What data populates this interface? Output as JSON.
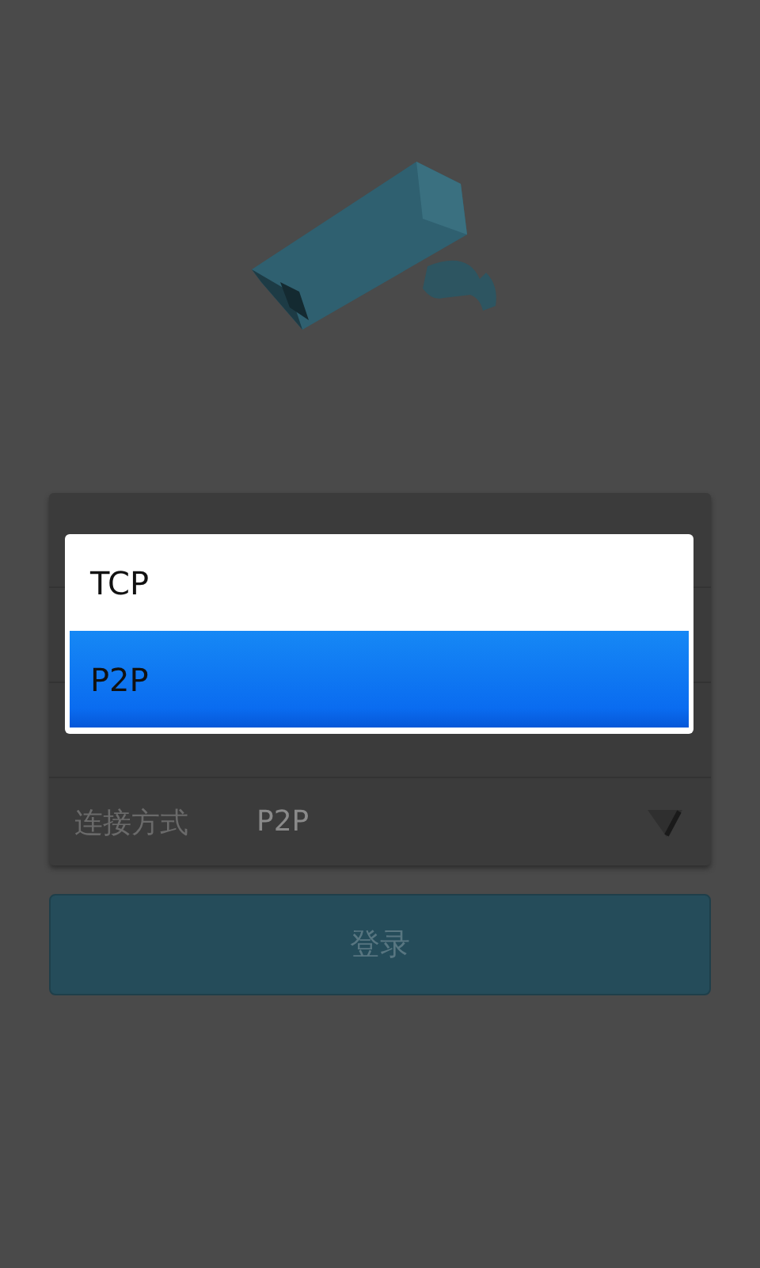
{
  "connection": {
    "label": "连接方式",
    "value": "P2P"
  },
  "login_button": {
    "label": "登录"
  },
  "dropdown": {
    "options": [
      {
        "label": "TCP",
        "selected": false
      },
      {
        "label": "P2P",
        "selected": true
      }
    ]
  }
}
